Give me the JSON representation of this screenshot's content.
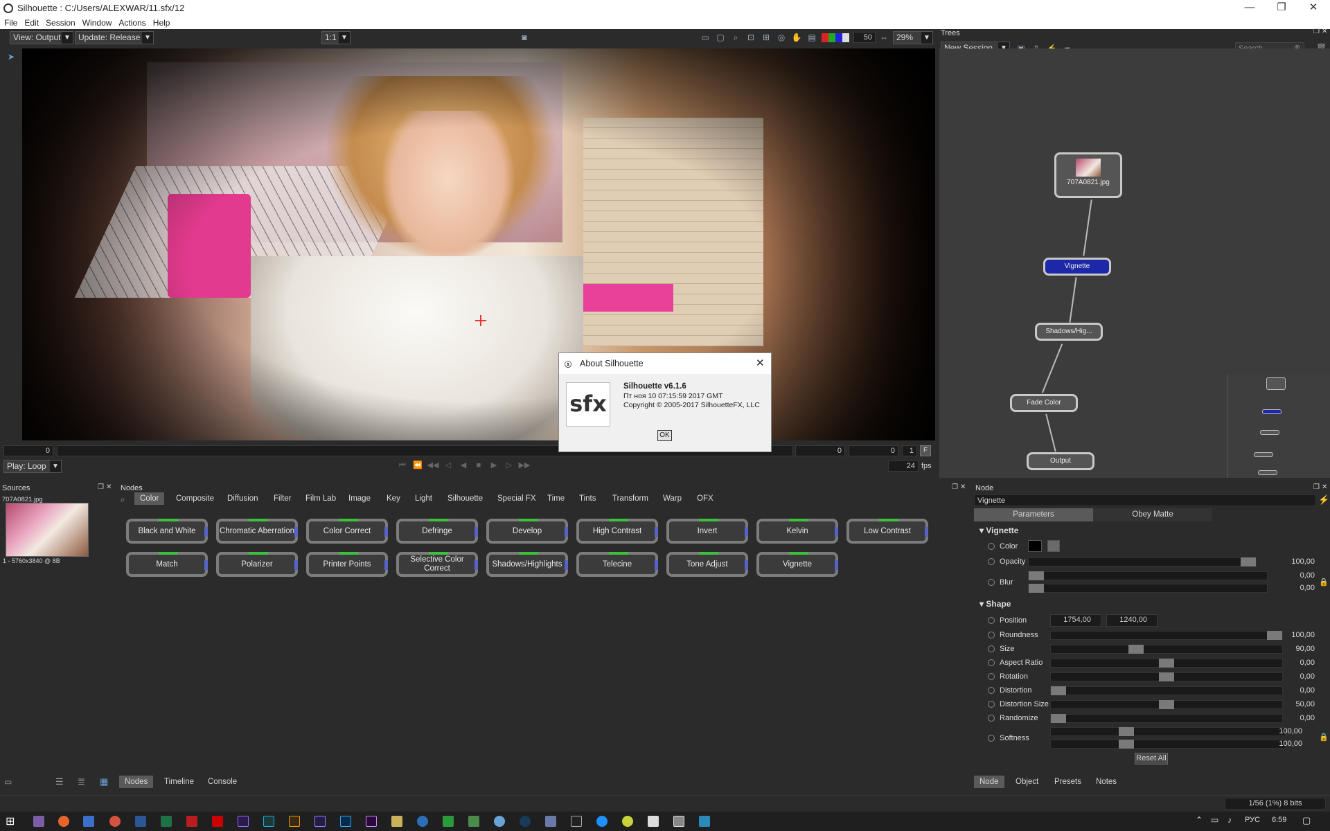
{
  "window": {
    "title": "Silhouette : C:/Users/ALEXWAR/11.sfx/12"
  },
  "menu": [
    "File",
    "Edit",
    "Session",
    "Window",
    "Actions",
    "Help"
  ],
  "viewer": {
    "view_select": "View: Output",
    "update_select": "Update: Release",
    "ratio_select": "1:1",
    "exposure_value": "50",
    "zoom_value": "29%",
    "timeline_start": "0",
    "frame_in": "0",
    "frame_current": "0",
    "frame_step": "1",
    "frame_flag": "F",
    "play_mode": "Play: Loop",
    "fps": "24",
    "fps_unit": "fps"
  },
  "trees": {
    "panel_title": "Trees",
    "session_select": "New Session",
    "search_placeholder": "Search",
    "nodes": [
      {
        "label": "707A0821.jpg"
      },
      {
        "label": "Vignette"
      },
      {
        "label": "Shadows/Hig..."
      },
      {
        "label": "Fade Color"
      },
      {
        "label": "Output"
      }
    ]
  },
  "sources": {
    "panel_title": "Sources",
    "item_name": "707A0821.jpg",
    "item_info": "1 - 5760x3840 @ 8B"
  },
  "nodes_panel": {
    "panel_title": "Nodes",
    "categories": [
      "Color",
      "Composite",
      "Diffusion",
      "Filter",
      "Film Lab",
      "Image",
      "Key",
      "Light",
      "Silhouette",
      "Special FX",
      "Time",
      "Tints",
      "Transform",
      "Warp",
      "OFX"
    ],
    "active_category": "Color",
    "buttons_row1": [
      "Black and White",
      "Chromatic Aberration",
      "Color Correct",
      "Defringe",
      "Develop",
      "High Contrast",
      "Invert",
      "Kelvin",
      "Low Contrast"
    ],
    "buttons_row2": [
      "Match",
      "Polarizer",
      "Printer Points",
      "Selective Color Correct",
      "Shadows/Highlights",
      "Telecine",
      "Tone Adjust",
      "Vignette"
    ]
  },
  "bottom_tabs_left": [
    "Nodes",
    "Timeline",
    "Console"
  ],
  "node_panel": {
    "panel_title": "Node",
    "node_name": "Vignette",
    "tab_parameters": "Parameters",
    "tab_obey": "Obey Matte",
    "section_vignette": "Vignette",
    "color_label": "Color",
    "opacity_label": "Opacity",
    "opacity_value": "100,00",
    "opacity_level": 1.0,
    "blur_label": "Blur",
    "blur_value1": "0,00",
    "blur_value2": "0,00",
    "section_shape": "Shape",
    "position_label": "Position",
    "position_x": "1754,00",
    "position_y": "1240,00",
    "params": [
      {
        "label": "Roundness",
        "value": "100,00",
        "level": 1.0
      },
      {
        "label": "Size",
        "value": "90,00",
        "level": 0.36
      },
      {
        "label": "Aspect Ratio",
        "value": "0,00",
        "level": 0.5
      },
      {
        "label": "Rotation",
        "value": "0,00",
        "level": 0.5
      },
      {
        "label": "Distortion",
        "value": "0,00",
        "level": 0.0
      },
      {
        "label": "Distortion Size",
        "value": "50,00",
        "level": 0.5
      },
      {
        "label": "Randomize",
        "value": "0,00",
        "level": 0.0
      }
    ],
    "softness_label": "Softness",
    "softness_value1": "100,00",
    "softness_value2": "100,00",
    "reset_label": "Reset All",
    "bottom_tabs": [
      "Node",
      "Object",
      "Presets",
      "Notes"
    ]
  },
  "status": {
    "info": "1/56 (1%) 8 bits"
  },
  "about_dialog": {
    "title": "About Silhouette",
    "logo_text": "sfx",
    "version": "Silhouette v6.1.6",
    "build_date": "Пт ноя 10 07:15:59 2017 GMT",
    "copyright": "Copyright © 2005-2017 SilhouetteFX, LLC",
    "ok_label": "OK"
  },
  "taskbar": {
    "lang": "РУС",
    "time": "6:59"
  }
}
